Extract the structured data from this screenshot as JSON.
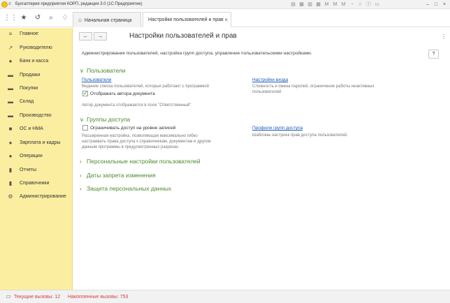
{
  "window": {
    "title": "Бухгалтерия предприятия КОРП, редакция 3.0  (1С:Предприятие)",
    "menu_icon": "menu-icon",
    "title_icons": [
      "doc-icon",
      "calendar-icon",
      "bookmarks-icon",
      "grid-icon",
      "m-icon",
      "m-plus-icon",
      "m-minus-icon",
      "bell-icon",
      "star-icon",
      "info-icon",
      "window-icon"
    ],
    "controls": {
      "minimize": "–",
      "restore": "□",
      "close": "×"
    }
  },
  "toolbar": {
    "icons": [
      "apps-icon",
      "star-icon",
      "history-icon",
      "search-icon",
      "bell-icon"
    ],
    "tabs": [
      {
        "label": "Начальная страница"
      },
      {
        "label": "Настройки пользователей и прав",
        "close": "×"
      }
    ]
  },
  "sidebar": {
    "items": [
      {
        "label": "Главное",
        "icon": "≡"
      },
      {
        "label": "Руководителю",
        "icon": "↗"
      },
      {
        "label": "Банк и касса",
        "icon": "●"
      },
      {
        "label": "Продажи",
        "icon": "▬"
      },
      {
        "label": "Покупки",
        "icon": "▬"
      },
      {
        "label": "Склад",
        "icon": "▬"
      },
      {
        "label": "Производство",
        "icon": "▬"
      },
      {
        "label": "ОС и НМА",
        "icon": "■"
      },
      {
        "label": "Зарплата и кадры",
        "icon": "●"
      },
      {
        "label": "Операции",
        "icon": "●"
      },
      {
        "label": "Отчеты",
        "icon": "▮"
      },
      {
        "label": "Справочники",
        "icon": "▮"
      },
      {
        "label": "Администрирование",
        "icon": "⚙"
      }
    ]
  },
  "main": {
    "back": "←",
    "forward": "→",
    "more": "⋮",
    "title": "Настройки пользователей и прав",
    "help": "?",
    "description": "Администрирование пользователей, настройка групп доступа, управление пользовательскими настройками.",
    "users": {
      "header": "Пользователи",
      "link": "Пользователи",
      "link_desc": "Ведение списка пользователей, которые работают с программой",
      "checkbox_label": "Отображать автора документа",
      "checkbox_checked": true,
      "checkbox_hint": "Автор документа отображается в поле \"Ответственный\".",
      "login_link": "Настройки входа",
      "login_desc_1": "Сложность и смена паролей, ограничение работы неактивных",
      "login_desc_2": "пользователей"
    },
    "access": {
      "header": "Группы доступа",
      "checkbox_label": "Ограничивать доступ на уровне записей",
      "checkbox_checked": false,
      "hint_1": "Расширенная настройка, позволяющая максимально гибко",
      "hint_2": "настраивать права доступа к справочникам, документам и другим",
      "hint_3": "данным программы в предусмотренных разрезах.",
      "profiles_link": "Профили групп доступа",
      "profiles_desc": "Шаблоны настроек прав доступа пользователей."
    },
    "collapsed": [
      {
        "label": "Персональные настройки пользователей"
      },
      {
        "label": "Даты запрета изменения"
      },
      {
        "label": "Защита персональных данных"
      }
    ]
  },
  "status": {
    "icon": "status-icon",
    "current_calls": "Текущие вызовы: 12",
    "accumulated_calls": "Накопленные вызовы: 753"
  },
  "colors": {
    "sidebar_bg": "#fbeea0",
    "group_header": "#4a8a2c",
    "link": "#1a58b4",
    "status_text": "#d04040"
  }
}
